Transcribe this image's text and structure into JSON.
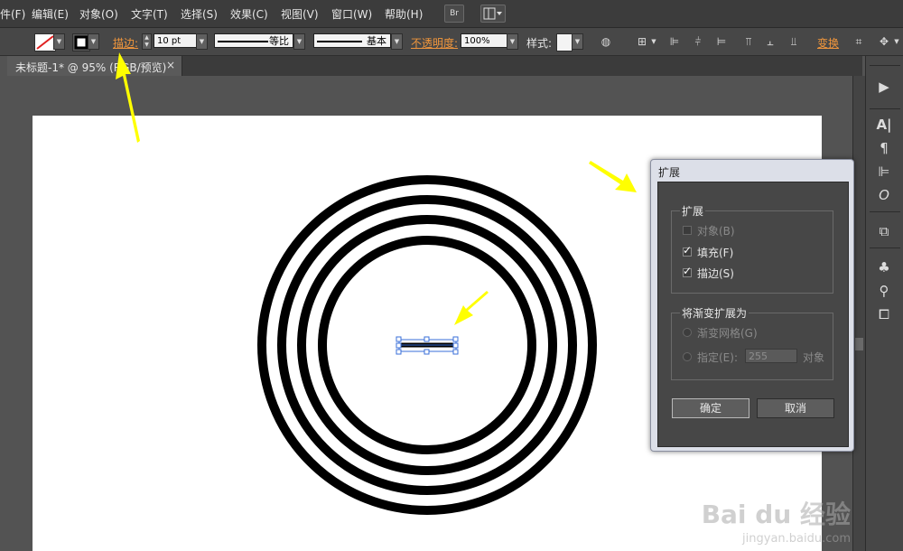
{
  "menu": [
    "件(F)",
    "编辑(E)",
    "对象(O)",
    "文字(T)",
    "选择(S)",
    "效果(C)",
    "视图(V)",
    "窗口(W)",
    "帮助(H)"
  ],
  "menu_bridge": "Br",
  "control": {
    "stroke_label": "描边:",
    "stroke_weight": "10 pt",
    "profile_label": "等比",
    "brush_label": "基本",
    "opacity_label": "不透明度:",
    "opacity_value": "100%",
    "style_label": "样式:",
    "transform_label": "变换"
  },
  "document_tab": {
    "title": "未标题-1* @ 95% (RGB/预览)",
    "close": "×"
  },
  "dialog": {
    "title": "扩展",
    "expand_group": "扩展",
    "object_label": "对象(B)",
    "fill_label": "填充(F)",
    "stroke_label": "描边(S)",
    "object_checked": false,
    "fill_checked": true,
    "stroke_checked": true,
    "gradient_group": "将渐变扩展为",
    "gradient_mesh_label": "渐变网格(G)",
    "specify_label": "指定(E):",
    "specify_value": "255",
    "specify_unit": "对象",
    "ok_button": "确定",
    "cancel_button": "取消"
  },
  "watermark": {
    "brand": "Bai du 经验",
    "url": "jingyan.baidu.com"
  },
  "colors": {
    "accent_orange": "#f0963c",
    "highlight_arrow": "#ffff00",
    "selection_blue": "#3a6fd8"
  }
}
